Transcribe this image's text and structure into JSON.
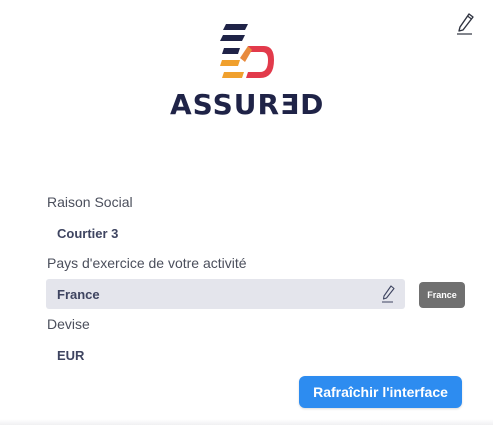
{
  "brand": {
    "name": "ASSURƎD",
    "colors": {
      "navy": "#1f2347",
      "orange": "#f0a02d",
      "red": "#e23a4b"
    }
  },
  "header": {
    "edit_icon": "pencil-icon"
  },
  "form": {
    "raison_social": {
      "label": "Raison Social",
      "value": "Courtier 3"
    },
    "pays": {
      "label": "Pays d'exercice de votre activité",
      "value": "France",
      "edit_icon": "pencil-icon",
      "badge": "France"
    },
    "devise": {
      "label": "Devise",
      "value": "EUR"
    }
  },
  "actions": {
    "refresh_label": "Rafraîchir l'interface",
    "accent": "#2d8cf0"
  }
}
